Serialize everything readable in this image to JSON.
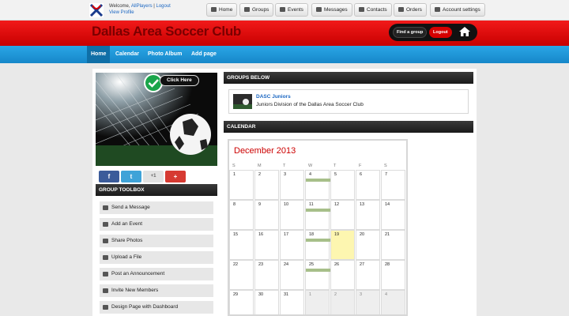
{
  "header": {
    "welcome_prefix": "Welcome, ",
    "user": "AllPlayers",
    "separator": " | ",
    "logout": "Logout",
    "view_profile": "View Profile",
    "nav": [
      {
        "label": "Home",
        "icon": "home-icon"
      },
      {
        "label": "Groups",
        "icon": "groups-icon"
      },
      {
        "label": "Events",
        "icon": "calendar-icon"
      },
      {
        "label": "Messages",
        "icon": "envelope-icon"
      },
      {
        "label": "Contacts",
        "icon": "contacts-icon"
      },
      {
        "label": "Orders",
        "icon": "cart-icon"
      },
      {
        "label": "Account settings",
        "icon": "user-icon"
      }
    ]
  },
  "banner": {
    "title": "Dallas Area Soccer Club",
    "find_group": "Find a group",
    "logout": "Logout"
  },
  "tabs": [
    {
      "label": "Home",
      "active": true
    },
    {
      "label": "Calendar",
      "active": false
    },
    {
      "label": "Photo Album",
      "active": false
    },
    {
      "label": "Add page",
      "active": false
    }
  ],
  "photo": {
    "click_here": "Click Here"
  },
  "share": [
    {
      "label": "f",
      "icon": "facebook-icon",
      "color": "#3b5b9a"
    },
    {
      "label": "t",
      "icon": "twitter-icon",
      "color": "#3fa3d8"
    },
    {
      "label": "+1",
      "icon": "google-plus-one-icon",
      "color": "#e2e2e2"
    },
    {
      "label": "+",
      "icon": "plus-icon",
      "color": "#d63a32"
    }
  ],
  "toolbox": {
    "title": "GROUP TOOLBOX",
    "items": [
      {
        "label": "Send a Message",
        "icon": "envelope-icon"
      },
      {
        "label": "Add an Event",
        "icon": "calendar-icon"
      },
      {
        "label": "Share Photos",
        "icon": "photo-icon"
      },
      {
        "label": "Upload a File",
        "icon": "folder-icon"
      },
      {
        "label": "Post an Announcement",
        "icon": "megaphone-icon"
      },
      {
        "label": "Invite New Members",
        "icon": "user-plus-icon"
      },
      {
        "label": "Design Page with Dashboard",
        "icon": "dashboard-icon"
      }
    ]
  },
  "groups_below": {
    "title": "GROUPS BELOW",
    "name": "DASC Juniors",
    "description": "Juniors Division of the Dallas Area Soccer Club"
  },
  "calendar": {
    "title": "CALENDAR",
    "month": "December 2013",
    "days_of_week": [
      "S",
      "M",
      "T",
      "W",
      "T",
      "F",
      "S"
    ],
    "weeks": [
      [
        "1",
        "2",
        "3",
        "4",
        "5",
        "6",
        "7"
      ],
      [
        "8",
        "9",
        "10",
        "11",
        "12",
        "13",
        "14"
      ],
      [
        "15",
        "16",
        "17",
        "18",
        "19",
        "20",
        "21"
      ],
      [
        "22",
        "23",
        "24",
        "25",
        "26",
        "27",
        "28"
      ],
      [
        "29",
        "30",
        "31",
        "1",
        "2",
        "3",
        "4"
      ]
    ],
    "event_days": [
      "4",
      "11",
      "18",
      "25"
    ],
    "today": "19"
  },
  "colors": {
    "brand_red": "#e60000",
    "nav_blue": "#1e96d6",
    "link_blue": "#1a66c2",
    "calendar_red": "#cc0000",
    "event_green": "#a7bf8a",
    "today_yellow": "#fdf6b0"
  }
}
